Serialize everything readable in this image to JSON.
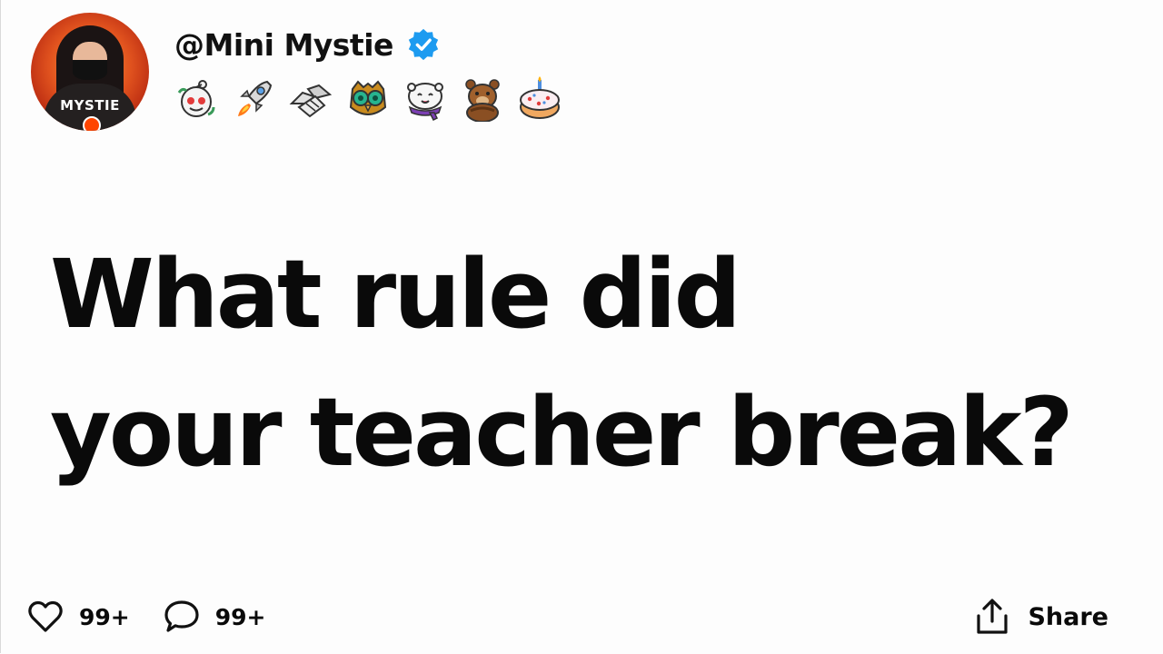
{
  "post": {
    "username": "@Mini Mystie",
    "verified": true,
    "avatar_text": "MYSTIE",
    "awards": [
      {
        "icon": "wholesome-snoo-award-icon"
      },
      {
        "icon": "rocket-award-icon"
      },
      {
        "icon": "handshake-award-icon"
      },
      {
        "icon": "owl-award-icon"
      },
      {
        "icon": "cozy-snoo-scarf-award-icon"
      },
      {
        "icon": "bear-award-icon"
      },
      {
        "icon": "cake-award-icon"
      }
    ],
    "question_line1": "What rule did",
    "question_line2": "your teacher break?"
  },
  "actions": {
    "likes": "99+",
    "comments": "99+",
    "share_label": "Share"
  },
  "colors": {
    "verified_blue": "#1d9bf0",
    "text": "#0a0a0a",
    "background": "#fdfdfd"
  }
}
